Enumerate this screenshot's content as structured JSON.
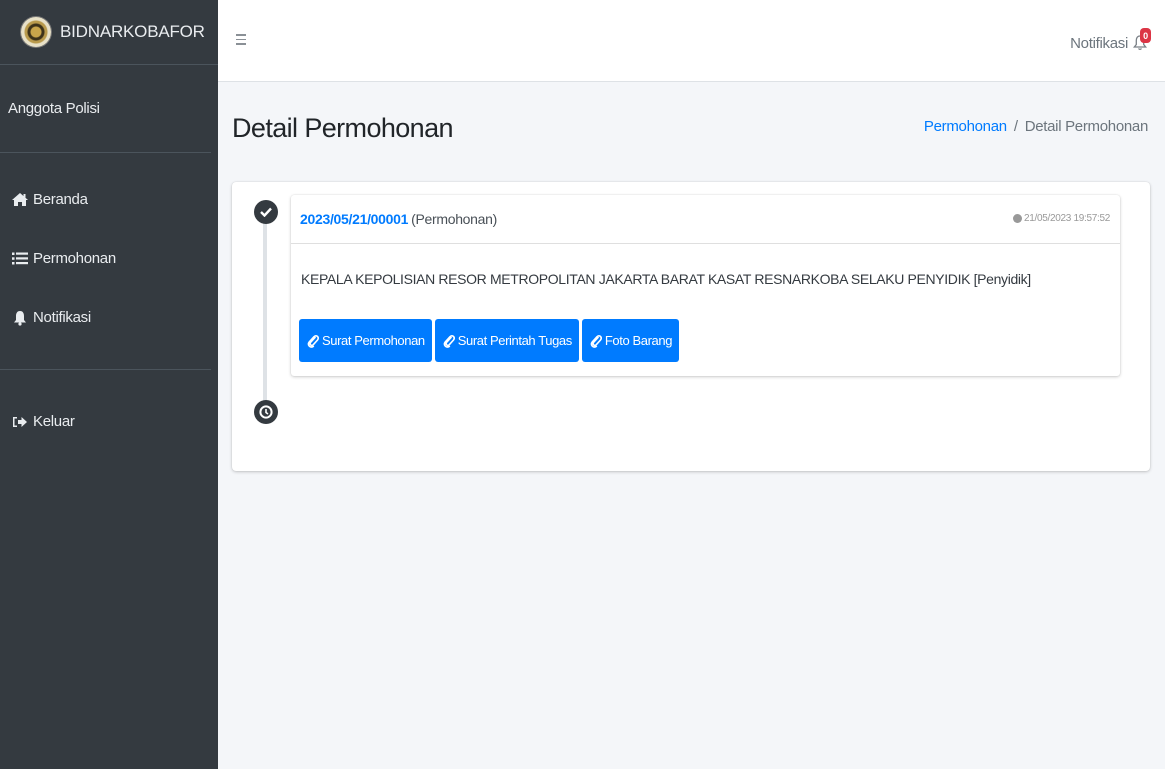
{
  "brand": {
    "name": "BIDNARKOBAFOR"
  },
  "user": {
    "name": "Anggota Polisi"
  },
  "sidebar": {
    "items": [
      {
        "label": "Beranda",
        "icon": "home-icon"
      },
      {
        "label": "Permohonan",
        "icon": "list-icon"
      },
      {
        "label": "Notifikasi",
        "icon": "bell-icon"
      }
    ],
    "logout": {
      "label": "Keluar",
      "icon": "sign-out-icon"
    }
  },
  "header": {
    "notif_label": "Notifikasi",
    "notif_count": "0"
  },
  "page": {
    "title": "Detail Permohonan",
    "breadcrumb": {
      "link": "Permohonan",
      "current": "Detail Permohonan",
      "separator": "/"
    }
  },
  "timeline": {
    "item": {
      "number": "2023/05/21/00001",
      "type": "(Permohonan)",
      "time": "21/05/2023 19:57:52",
      "body": "KEPALA KEPOLISIAN RESOR METROPOLITAN JAKARTA BARAT KASAT RESNARKOBA SELAKU PENYIDIK [Penyidik]",
      "buttons": [
        "Surat Permohonan",
        "Surat Perintah Tugas",
        "Foto Barang"
      ]
    }
  },
  "colors": {
    "sidebar_bg": "#343a40",
    "primary": "#007bff",
    "badge": "#dc3545",
    "content_bg": "#f4f6f9"
  }
}
